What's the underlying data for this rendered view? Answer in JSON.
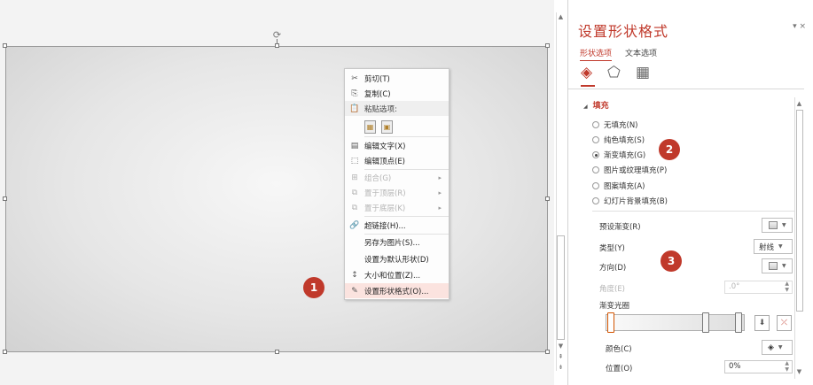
{
  "context_menu": {
    "items": [
      {
        "icon": "✂",
        "label": "剪切(T)"
      },
      {
        "icon": "⎘",
        "label": "复制(C)"
      },
      {
        "icon": "📋",
        "label": "粘贴选项:"
      },
      {
        "icon": "▤",
        "label": "编辑文字(X)"
      },
      {
        "icon": "⬚",
        "label": "编辑顶点(E)"
      },
      {
        "icon": "⊞",
        "label": "组合(G)"
      },
      {
        "icon": "⧉",
        "label": "置于顶层(R)"
      },
      {
        "icon": "⧉",
        "label": "置于底层(K)"
      },
      {
        "icon": "🔗",
        "label": "超链接(H)..."
      },
      {
        "icon": "",
        "label": "另存为图片(S)..."
      },
      {
        "icon": "",
        "label": "设置为默认形状(D)"
      },
      {
        "icon": "↕",
        "label": "大小和位置(Z)..."
      },
      {
        "icon": "✎",
        "label": "设置形状格式(O)..."
      }
    ]
  },
  "pane": {
    "title": "设置形状格式",
    "controls": "▾ ×",
    "tabs": [
      "形状选项",
      "文本选项"
    ],
    "section": "填充",
    "fill_options": [
      "无填充(N)",
      "纯色填充(S)",
      "渐变填充(G)",
      "图片或纹理填充(P)",
      "图案填充(A)",
      "幻灯片背景填充(B)"
    ],
    "selected_fill": "渐变填充(G)",
    "preset_label": "预设渐变(R)",
    "type_label": "类型(Y)",
    "type_value": "射线",
    "direction_label": "方向(D)",
    "angle_label": "角度(E)",
    "angle_value": ".0°",
    "stops_label": "渐变光圈",
    "color_label": "颜色(C)",
    "position_label": "位置(O)",
    "position_value": "0%"
  },
  "badges": [
    "1",
    "2",
    "3"
  ],
  "colors": {
    "accent": "#c0392b"
  }
}
